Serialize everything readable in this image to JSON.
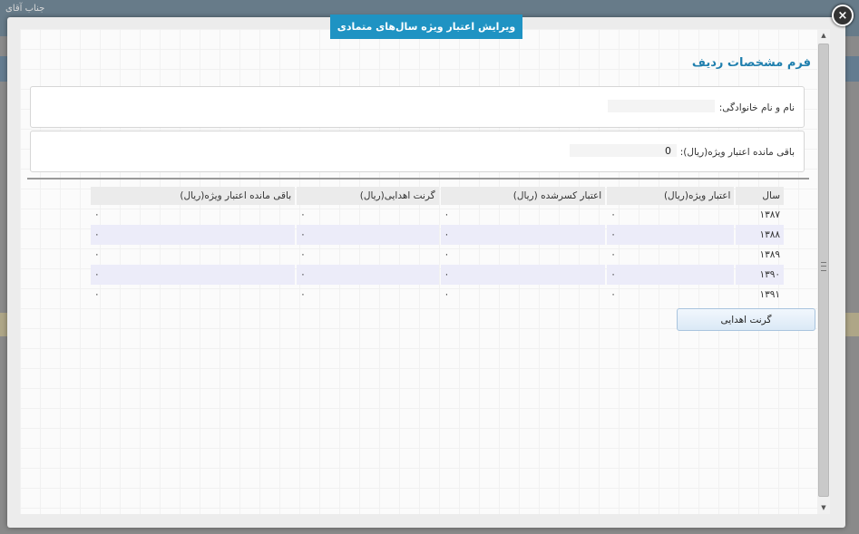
{
  "background": {
    "corner_text": "جناب آقای"
  },
  "modal": {
    "title": "ویرایش اعتبار ویژه سال‌های متمادی",
    "close_symbol": "×",
    "form_title": "فرم مشخصات ردیف",
    "fields": {
      "name_label": "نام و نام خانوادگی:",
      "remaining_label": "باقی مانده اعتبار ویژه(ریال):",
      "remaining_value": "0"
    },
    "table": {
      "headers": [
        "سال",
        "اعتبار ویژه(ریال)",
        "اعتبار کسرشده (ریال)",
        "گرنت اهدایی(ریال)",
        "باقی مانده اعتبار ویژه(ریال)"
      ],
      "rows": [
        [
          "۱۳۸۷",
          "۰",
          "۰",
          "۰",
          "۰"
        ],
        [
          "۱۳۸۸",
          "۰",
          "۰",
          "۰",
          "۰"
        ],
        [
          "۱۳۸۹",
          "۰",
          "۰",
          "۰",
          "۰"
        ],
        [
          "۱۳۹۰",
          "۰",
          "۰",
          "۰",
          "۰"
        ],
        [
          "۱۳۹۱",
          "۰",
          "۰",
          "۰",
          "۰"
        ]
      ]
    },
    "grant_button": "گرنت اهدایی"
  },
  "icons": {
    "close": "close-icon",
    "scroll_up": "scroll-up-icon",
    "scroll_down": "scroll-down-icon"
  },
  "colors": {
    "title_bg": "#1f93c3",
    "form_title": "#1f7fae",
    "alt_row": "#ececf9"
  }
}
